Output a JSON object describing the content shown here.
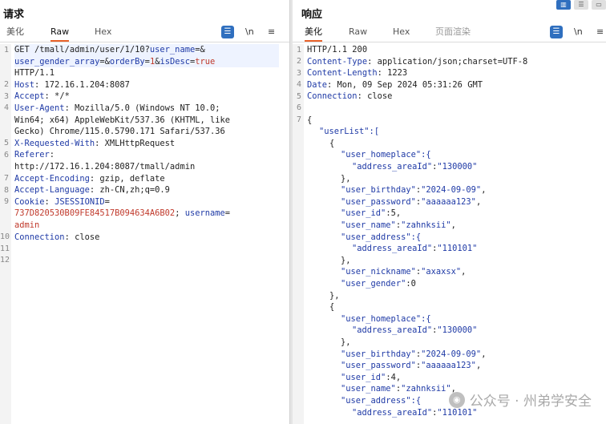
{
  "request": {
    "title": "请求",
    "tabs": [
      "美化",
      "Raw",
      "Hex"
    ],
    "active_tab": "Raw",
    "newline_label": "\\n",
    "menu_label": "≡",
    "line_numbers": [
      "1",
      "2",
      "3",
      "4",
      "5",
      "6",
      "7",
      "8",
      "9",
      "10",
      "11",
      "12"
    ],
    "lines": {
      "l1a": "GET /tmall/admin/user/1/10?",
      "l1b": "user_name",
      "l1c": "=&",
      "l1d": "user_gender_array",
      "l1e": "=&",
      "l1f": "orderBy",
      "l1g": "=",
      "l1h": "1",
      "l1i": "&",
      "l1j": "isDesc",
      "l1k": "=",
      "l1l": "true",
      "l1m": "HTTP/1.1",
      "l2k": "Host",
      "l2v": ": 172.16.1.204:8087",
      "l3k": "Accept",
      "l3v": ": */*",
      "l4k": "User-Agent",
      "l4v": ": Mozilla/5.0 (Windows NT 10.0;",
      "l4v2": "Win64; x64) AppleWebKit/537.36 (KHTML, like",
      "l4v3": "Gecko) Chrome/115.0.5790.171 Safari/537.36",
      "l5k": "X-Requested-With",
      "l5v": ": XMLHttpRequest",
      "l6k": "Referer",
      "l6v": ":",
      "l6v2": "http://172.16.1.204:8087/tmall/admin",
      "l7k": "Accept-Encoding",
      "l7v": ": gzip, deflate",
      "l8k": "Accept-Language",
      "l8v": ": zh-CN,zh;q=0.9",
      "l9k": "Cookie",
      "l9v": ": ",
      "l9c": "JSESSIONID",
      "l9e": "=",
      "l9val": "737D820530B09FE84517B094634A6B02",
      "l9sep": "; ",
      "l9c2": "username",
      "l9e2": "=",
      "l9val2": "admin",
      "l10k": "Connection",
      "l10v": ": close"
    }
  },
  "response": {
    "title": "响应",
    "tabs": [
      "美化",
      "Raw",
      "Hex",
      "页面渲染"
    ],
    "active_tab": "美化",
    "newline_label": "\\n",
    "menu_label": "≡",
    "line_numbers": [
      "1",
      "2",
      "3",
      "4",
      "5",
      "6",
      "7"
    ],
    "lines": {
      "r1": "HTTP/1.1 200",
      "r2k": "Content-Type",
      "r2v": ": application/json;charset=UTF-8",
      "r3k": "Content-Length",
      "r3v": ": 1223",
      "r4k": "Date",
      "r4v": ": Mon, 09 Sep 2024 05:31:26 GMT",
      "r5k": "Connection",
      "r5v": ": close",
      "r7": "{",
      "j_userList": "\"userList\":[",
      "j_open1": "{",
      "j_homeplace1": "\"user_homeplace\":{",
      "j_area1k": "\"address_areaId\"",
      "j_area1v": "\"130000\"",
      "j_close1a": "},",
      "j_birth1k": "\"user_birthday\"",
      "j_birth1v": "\"2024-09-09\"",
      "j_pass1k": "\"user_password\"",
      "j_pass1v": "\"aaaaaa123\"",
      "j_id1k": "\"user_id\"",
      "j_id1v": "5",
      "j_name1k": "\"user_name\"",
      "j_name1v": "\"zahnksii\"",
      "j_addr1": "\"user_address\":{",
      "j_addr1k": "\"address_areaId\"",
      "j_addr1v": "\"110101\"",
      "j_close1b": "},",
      "j_nick1k": "\"user_nickname\"",
      "j_nick1v": "\"axaxsx\"",
      "j_gender1k": "\"user_gender\"",
      "j_gender1v": "0",
      "j_close1": "},",
      "j_open2": "{",
      "j_homeplace2": "\"user_homeplace\":{",
      "j_area2k": "\"address_areaId\"",
      "j_area2v": "\"130000\"",
      "j_close2a": "},",
      "j_birth2k": "\"user_birthday\"",
      "j_birth2v": "\"2024-09-09\"",
      "j_pass2k": "\"user_password\"",
      "j_pass2v": "\"aaaaaa123\"",
      "j_id2k": "\"user_id\"",
      "j_id2v": "4",
      "j_name2k": "\"user_name\"",
      "j_name2v": "\"zahnksii\"",
      "j_addr2": "\"user_address\":{",
      "j_addr2k": "\"address_areaId\"",
      "j_addr2v": "\"110101\""
    }
  },
  "watermark": "公众号 · 州弟学安全",
  "colors": {
    "accent_tab": "#e8622a",
    "key": "#1f3aa6",
    "value": "#c0392b",
    "tool_blue": "#2f6fbf"
  }
}
